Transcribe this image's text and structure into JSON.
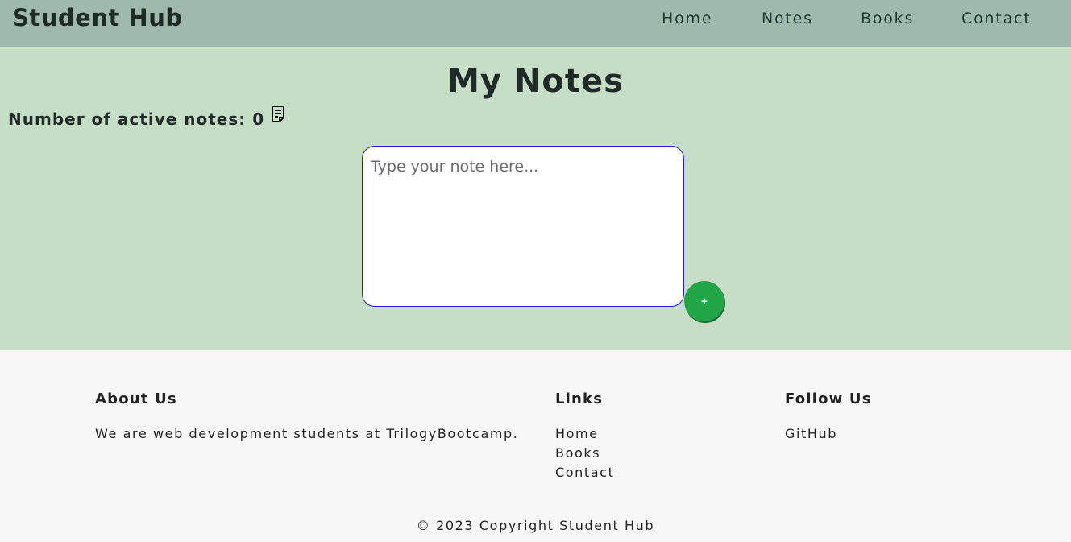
{
  "header": {
    "brand": "Student Hub",
    "nav": [
      "Home",
      "Notes",
      "Books",
      "Contact"
    ]
  },
  "main": {
    "title": "My Notes",
    "counter_label": "Number of active notes: 0",
    "note_placeholder": "Type your note here...",
    "add_label": "+",
    "icon": "note-icon"
  },
  "footer": {
    "about_heading": "About Us",
    "about_text": "We are web development students at TrilogyBootcamp.",
    "links_heading": "Links",
    "links": [
      "Home",
      "Books",
      "Contact"
    ],
    "follow_heading": "Follow Us",
    "follow_links": [
      "GitHub"
    ],
    "copyright": "© 2023 Copyright Student Hub"
  },
  "colors": {
    "navbar": "#a0b9ad",
    "main_bg": "#c6dec6",
    "footer_bg": "#f7f7f7",
    "add_button": "#22a546",
    "input_border": "#2a1bd0"
  }
}
